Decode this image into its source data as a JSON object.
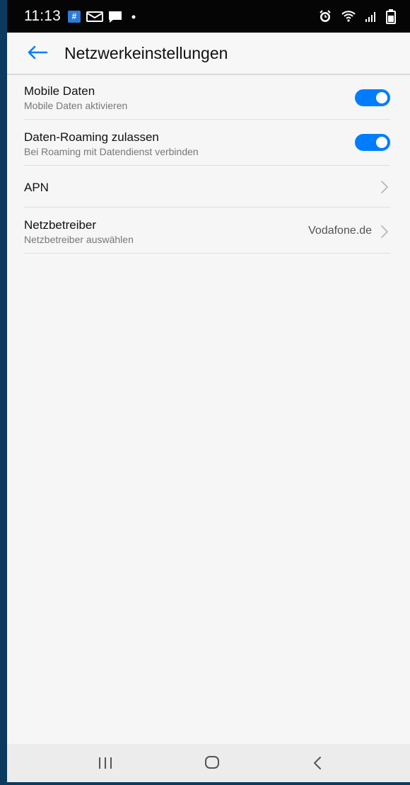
{
  "status_bar": {
    "time": "11:13",
    "app_badge": "#",
    "icons": [
      "hash-app-icon",
      "gmail-icon",
      "message-icon",
      "dot-icon",
      "alarm-icon",
      "wifi-icon",
      "signal-icon",
      "battery-icon"
    ]
  },
  "toolbar": {
    "title": "Netzwerkeinstellungen",
    "back_icon": "arrow-left-icon"
  },
  "settings": {
    "mobile_data": {
      "title": "Mobile Daten",
      "subtitle": "Mobile Daten aktivieren",
      "enabled": true
    },
    "roaming": {
      "title": "Daten-Roaming zulassen",
      "subtitle": "Bei Roaming mit Datendienst verbinden",
      "enabled": true
    },
    "apn": {
      "title": "APN"
    },
    "carrier": {
      "title": "Netzbetreiber",
      "subtitle": "Netzbetreiber auswählen",
      "value": "Vodafone.de"
    }
  },
  "navigation_bar": {
    "icons": [
      "recent-apps-icon",
      "home-icon",
      "back-icon"
    ]
  },
  "colors": {
    "accent": "#007DFF",
    "status_bar": "#050505",
    "background": "#F6F6F6"
  }
}
